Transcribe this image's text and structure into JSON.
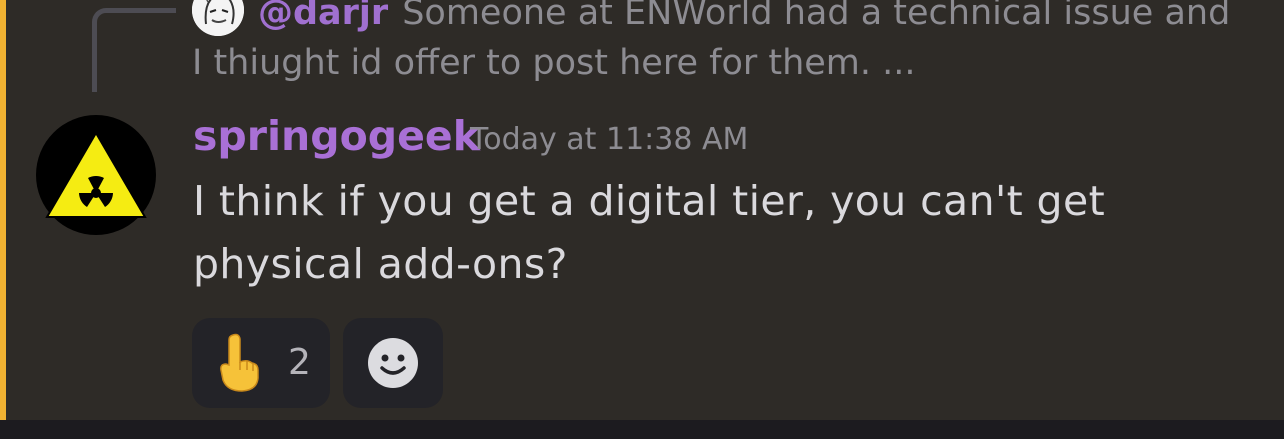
{
  "reply": {
    "author": "@darjr",
    "preview_line1": "Someone at ENWorld had a technical issue and",
    "preview_line2": "I thiught id offer to post here for them. ..."
  },
  "message": {
    "author": "springogeek",
    "timestamp": "Today at 11:38 AM",
    "text": "I think if you get a digital tier, you can't get physical add-ons?"
  },
  "reactions": [
    {
      "emoji": "point-up-emoji",
      "count": "2"
    }
  ],
  "add_reaction": {
    "icon": "smiley-add-icon"
  },
  "colors": {
    "username": "#a970d6",
    "mention_bar": "#f0b232",
    "background": "#2e2b27"
  }
}
